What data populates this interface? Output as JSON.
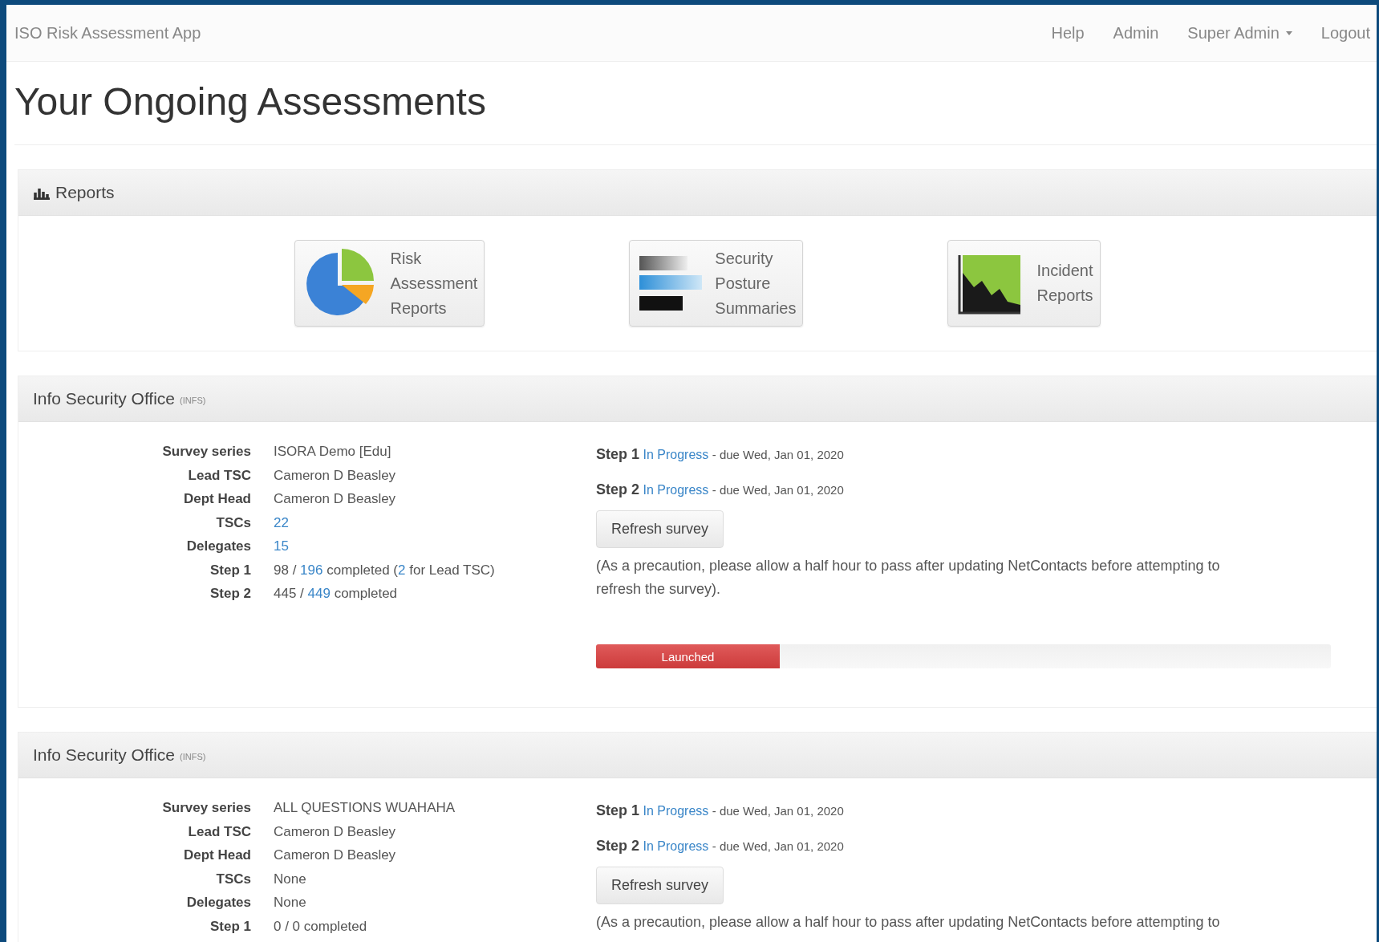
{
  "navbar": {
    "brand": "ISO Risk Assessment App",
    "links": [
      {
        "label": "Help",
        "kind": "link"
      },
      {
        "label": "Admin",
        "kind": "link"
      },
      {
        "label": "Super Admin",
        "kind": "dropdown"
      },
      {
        "label": "Logout",
        "kind": "link"
      }
    ]
  },
  "page_title": "Your Ongoing Assessments",
  "reports": {
    "title": "Reports",
    "tiles": [
      {
        "label": "Risk Assessment Reports",
        "kind": "pie"
      },
      {
        "label": "Security Posture Summaries",
        "kind": "bars"
      },
      {
        "label": "Incident Reports",
        "kind": "area"
      }
    ]
  },
  "offices": [
    {
      "title": "Info Security Office",
      "tag": "(INFS)",
      "details": [
        {
          "label": "Survey series",
          "value": [
            {
              "text": "ISORA Demo [Edu]",
              "link": false
            }
          ]
        },
        {
          "label": "Lead TSC",
          "value": [
            {
              "text": "Cameron D Beasley",
              "link": false
            }
          ]
        },
        {
          "label": "Dept Head",
          "value": [
            {
              "text": "Cameron D Beasley",
              "link": false
            }
          ]
        },
        {
          "label": "TSCs",
          "value": [
            {
              "text": "22",
              "link": true
            }
          ]
        },
        {
          "label": "Delegates",
          "value": [
            {
              "text": "15",
              "link": true
            }
          ]
        },
        {
          "label": "Step 1",
          "value": [
            {
              "text": "98 / ",
              "link": false
            },
            {
              "text": "196",
              "link": true
            },
            {
              "text": " completed (",
              "link": false
            },
            {
              "text": "2",
              "link": true
            },
            {
              "text": " for Lead TSC)",
              "link": false
            }
          ]
        },
        {
          "label": "Step 2",
          "value": [
            {
              "text": "445 / ",
              "link": false
            },
            {
              "text": "449",
              "link": true
            },
            {
              "text": " completed",
              "link": false
            }
          ]
        }
      ],
      "steps": [
        {
          "label": "Step 1",
          "status": "In Progress",
          "due": "- due Wed, Jan 01, 2020"
        },
        {
          "label": "Step 2",
          "status": "In Progress",
          "due": "- due Wed, Jan 01, 2020"
        }
      ],
      "refresh_button": "Refresh survey",
      "note": "(As a precaution, please allow a half hour to pass after updating NetContacts before attempting to refresh the survey).",
      "progress": {
        "label": "Launched",
        "level": 0.25
      }
    },
    {
      "title": "Info Security Office",
      "tag": "(INFS)",
      "details": [
        {
          "label": "Survey series",
          "value": [
            {
              "text": "ALL QUESTIONS WUAHAHA",
              "link": false
            }
          ]
        },
        {
          "label": "Lead TSC",
          "value": [
            {
              "text": "Cameron D Beasley",
              "link": false
            }
          ]
        },
        {
          "label": "Dept Head",
          "value": [
            {
              "text": "Cameron D Beasley",
              "link": false
            }
          ]
        },
        {
          "label": "TSCs",
          "value": [
            {
              "text": "None",
              "link": false
            }
          ]
        },
        {
          "label": "Delegates",
          "value": [
            {
              "text": "None",
              "link": false
            }
          ]
        },
        {
          "label": "Step 1",
          "value": [
            {
              "text": "0 / 0 completed",
              "link": false
            }
          ]
        }
      ],
      "steps": [
        {
          "label": "Step 1",
          "status": "In Progress",
          "due": "- due Wed, Jan 01, 2020"
        },
        {
          "label": "Step 2",
          "status": "In Progress",
          "due": "- due Wed, Jan 01, 2020"
        }
      ],
      "refresh_button": "Refresh survey",
      "note": "(As a precaution, please allow a half hour to pass after updating NetContacts before attempting to"
    }
  ]
}
